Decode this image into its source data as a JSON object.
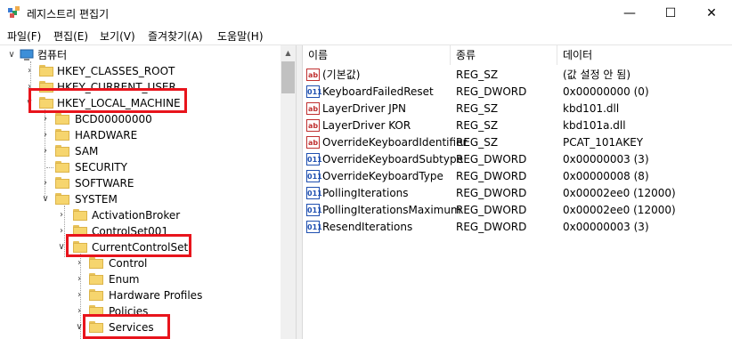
{
  "window": {
    "title": "레지스트리 편집기"
  },
  "menu": [
    "파일(F)",
    "편집(E)",
    "보기(V)",
    "즐겨찾기(A)",
    "도움말(H)"
  ],
  "tree": {
    "root": "컴퓨터",
    "nodes": [
      {
        "label": "HKEY_CLASSES_ROOT"
      },
      {
        "label": "HKEY_CURRENT_USER"
      },
      {
        "label": "HKEY_LOCAL_MACHINE"
      },
      {
        "label": "BCD00000000"
      },
      {
        "label": "HARDWARE"
      },
      {
        "label": "SAM"
      },
      {
        "label": "SECURITY"
      },
      {
        "label": "SOFTWARE"
      },
      {
        "label": "SYSTEM"
      },
      {
        "label": "ActivationBroker"
      },
      {
        "label": "ControlSet001"
      },
      {
        "label": "CurrentControlSet"
      },
      {
        "label": "Control"
      },
      {
        "label": "Enum"
      },
      {
        "label": "Hardware Profiles"
      },
      {
        "label": "Policies"
      },
      {
        "label": "Services"
      }
    ]
  },
  "columns": {
    "name": "이름",
    "type": "종류",
    "data": "데이터"
  },
  "values": [
    {
      "name": "(기본값)",
      "type": "REG_SZ",
      "data": "(값 설정 안 됨)",
      "icon": "string-value-icon"
    },
    {
      "name": "KeyboardFailedReset",
      "type": "REG_DWORD",
      "data": "0x00000000 (0)",
      "icon": "binary-value-icon"
    },
    {
      "name": "LayerDriver JPN",
      "type": "REG_SZ",
      "data": "kbd101.dll",
      "icon": "string-value-icon"
    },
    {
      "name": "LayerDriver KOR",
      "type": "REG_SZ",
      "data": "kbd101a.dll",
      "icon": "string-value-icon"
    },
    {
      "name": "OverrideKeyboardIdentifier",
      "type": "REG_SZ",
      "data": "PCAT_101AKEY",
      "icon": "string-value-icon"
    },
    {
      "name": "OverrideKeyboardSubtype",
      "type": "REG_DWORD",
      "data": "0x00000003 (3)",
      "icon": "binary-value-icon"
    },
    {
      "name": "OverrideKeyboardType",
      "type": "REG_DWORD",
      "data": "0x00000008 (8)",
      "icon": "binary-value-icon"
    },
    {
      "name": "PollingIterations",
      "type": "REG_DWORD",
      "data": "0x00002ee0 (12000)",
      "icon": "binary-value-icon"
    },
    {
      "name": "PollingIterationsMaximum",
      "type": "REG_DWORD",
      "data": "0x00002ee0 (12000)",
      "icon": "binary-value-icon"
    },
    {
      "name": "ResendIterations",
      "type": "REG_DWORD",
      "data": "0x00000003 (3)",
      "icon": "binary-value-icon"
    }
  ],
  "icons": {
    "sz": "ab",
    "bin": "011"
  },
  "colors": {
    "highlight_box": "#e8141c",
    "folder": "#f6d56e"
  }
}
